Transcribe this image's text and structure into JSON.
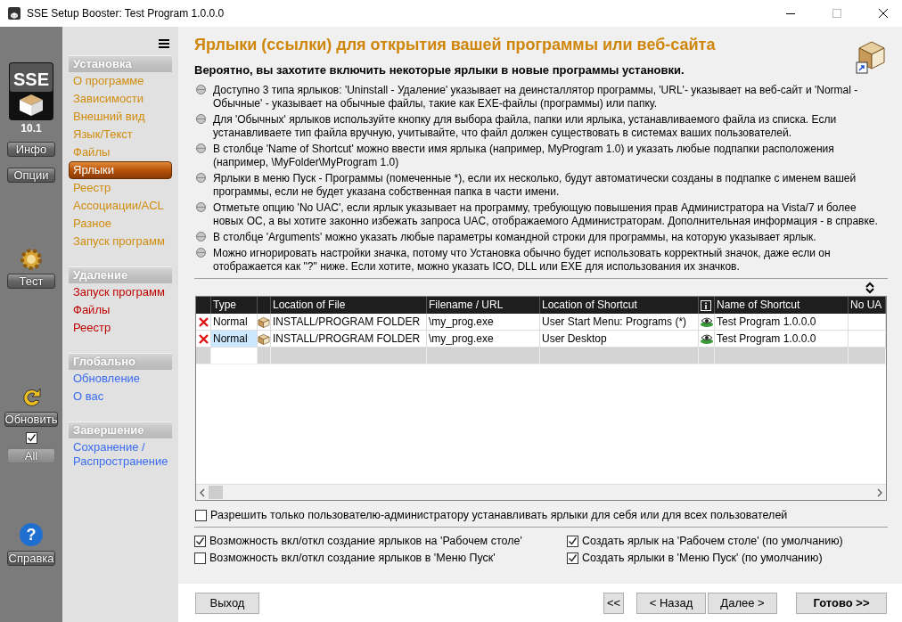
{
  "window": {
    "title": "SSE Setup Booster: Test Program 1.0.0.0"
  },
  "toolstrip": {
    "logo_text": "SSE",
    "help_symbol": "?",
    "version": "10.1",
    "info_button": "Инфо",
    "options_button": "Опции",
    "test_button": "Тест",
    "refresh_button": "Обновить",
    "all_checked": true,
    "all_button": "All",
    "help_button": "Справка"
  },
  "nav": {
    "sections": [
      {
        "title": "Установка",
        "color": "#d08c0c",
        "items": [
          {
            "label": "О программе",
            "selected": false
          },
          {
            "label": "Зависимости",
            "selected": false
          },
          {
            "label": "Внешний вид",
            "selected": false
          },
          {
            "label": "Язык/Текст",
            "selected": false
          },
          {
            "label": "Файлы",
            "selected": false
          },
          {
            "label": "Ярлыки",
            "selected": true
          },
          {
            "label": "Реестр",
            "selected": false
          },
          {
            "label": "Ассоциации/ACL",
            "selected": false
          },
          {
            "label": "Разное",
            "selected": false
          },
          {
            "label": "Запуск программ",
            "selected": false
          }
        ]
      },
      {
        "title": "Удаление",
        "color": "#c00000",
        "items": [
          {
            "label": "Запуск программ",
            "selected": false
          },
          {
            "label": "Файлы",
            "selected": false
          },
          {
            "label": "Реестр",
            "selected": false
          }
        ]
      },
      {
        "title": "Глобально",
        "color": "#3b6cf2",
        "items": [
          {
            "label": "Обновление",
            "selected": false
          },
          {
            "label": "О вас",
            "selected": false
          }
        ]
      },
      {
        "title": "Завершение",
        "color": "#3b6cf2",
        "items": [
          {
            "label": "Сохранение / Распространение",
            "selected": false
          }
        ]
      }
    ]
  },
  "page": {
    "heading": "Ярлыки (ссылки) для открытия вашей программы или веб-сайта",
    "subheading": "Вероятно, вы захотите включить некоторые ярлыки в новые программы установки.",
    "bullets": [
      "Доступно 3 типа ярлыков: 'Uninstall - Удаление' указывает на деинсталлятор программы, 'URL'- указывает на веб-сайт и 'Normal - Обычные' - указывает на обычные файлы, такие как EXE-файлы (программы) или папку.",
      "Для 'Обычных' ярлыков используйте кнопку для выбора файла, папки или ярлыка, устанавливаемого файла из списка. Если устанавливаете тип файла вручную, учитывайте, что файл должен существовать в системах ваших пользователей.",
      "В столбце 'Name of Shortcut' можно ввести имя ярлыка (например, MyProgram 1.0) и указать любые подпапки расположения (например, \\MyFolder\\MyProgram 1.0)",
      "Ярлыки в меню Пуск - Программы (помеченные *), если их несколько, будут автоматически созданы в подпапке с именем вашей программы, если не будет указана собственная папка в части имени.",
      "Отметьте опцию 'No UAC', если ярлык указывает на программу, требующую повышения прав Администратора на Vista/7 и более новых ОС, а вы хотите законно избежать запроса UAC, отображаемого Администраторам. Дополнительная информация - в справке.",
      "В столбце 'Arguments' можно указать любые параметры командной строки для программы, на которую указывает ярлык.",
      "Можно игнорировать настройки значка, потому что Установка обычно будет использовать корректный значок, даже если он отображается как \"?\" ниже. Если хотите, можно указать ICO, DLL или EXE для использования их значков."
    ]
  },
  "table": {
    "columns": [
      "Type",
      "Location of File",
      "Filename / URL",
      "Location of Shortcut",
      "Name of Shortcut",
      "No UA"
    ],
    "rows": [
      {
        "type": "Normal",
        "location_of_file": "INSTALL/PROGRAM FOLDER",
        "filename": "\\my_prog.exe",
        "location_of_shortcut": "User Start Menu: Programs (*)",
        "name_of_shortcut": "Test Program 1.0.0.0",
        "selected": false
      },
      {
        "type": "Normal",
        "location_of_file": "INSTALL/PROGRAM FOLDER",
        "filename": "\\my_prog.exe",
        "location_of_shortcut": "User Desktop",
        "name_of_shortcut": "Test Program 1.0.0.0",
        "selected": true
      }
    ]
  },
  "admin_only": {
    "label": "Разрешить только пользователю-администратору устанавливать ярлыки для себя или для всех пользователей",
    "checked": false
  },
  "options": [
    {
      "label": "Возможность вкл/откл создание ярлыков на 'Рабочем столе'",
      "checked": true
    },
    {
      "label": "Создать ярлык на 'Рабочем столе' (по умолчанию)",
      "checked": true
    },
    {
      "label": "Возможность вкл/откл создание ярлыков в 'Меню Пуск'",
      "checked": false
    },
    {
      "label": "Создать ярлыки в 'Меню Пуск' (по умолчанию)",
      "checked": true
    }
  ],
  "buttons": {
    "exit": "Выход",
    "first": "<<",
    "back": "< Назад",
    "next": "Далее >",
    "finish": "Готово >>"
  }
}
